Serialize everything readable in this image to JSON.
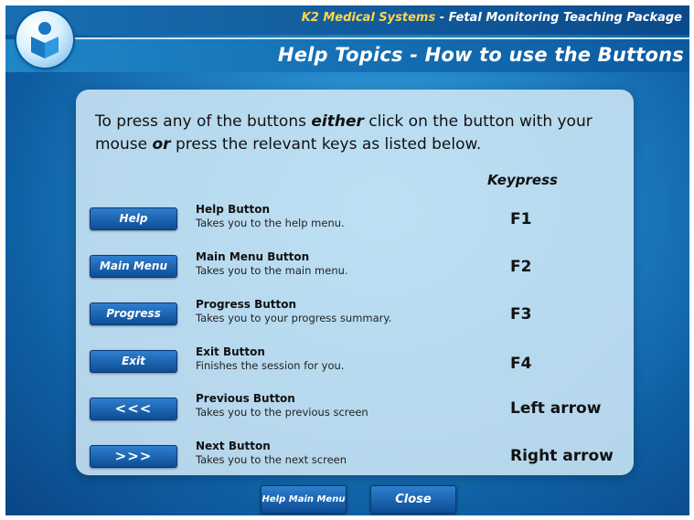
{
  "header": {
    "company": "K2 Medical Systems",
    "separator": " - ",
    "product": "Fetal Monitoring Teaching Package",
    "page_title": "Help Topics - How to use the Buttons"
  },
  "intro": {
    "part1": "To press any of the buttons ",
    "either": "either",
    "part2": " click on the button with your mouse ",
    "or": "or",
    "part3": " press the relevant keys as listed below."
  },
  "keypress_header": "Keypress",
  "rows": [
    {
      "button": "Help",
      "title": "Help Button",
      "text": "Takes you to the help menu.",
      "key": "F1"
    },
    {
      "button": "Main Menu",
      "title": "Main Menu Button",
      "text": "Takes you to the main menu.",
      "key": "F2"
    },
    {
      "button": "Progress",
      "title": "Progress Button",
      "text": "Takes you to your progress summary.",
      "key": "F3"
    },
    {
      "button": "Exit",
      "title": "Exit Button",
      "text": "Finishes the session for you.",
      "key": "F4"
    },
    {
      "button": "<<<",
      "title": "Previous Button",
      "text": "Takes you to the previous screen",
      "key": "Left arrow"
    },
    {
      "button": ">>>",
      "title": "Next Button",
      "text": "Takes you to the next screen",
      "key": "Right arrow"
    }
  ],
  "footer": {
    "help_main_menu": "Help Main Menu",
    "close": "Close"
  },
  "colors": {
    "accent": "#0d4d95",
    "company_text": "#ffd64a"
  }
}
